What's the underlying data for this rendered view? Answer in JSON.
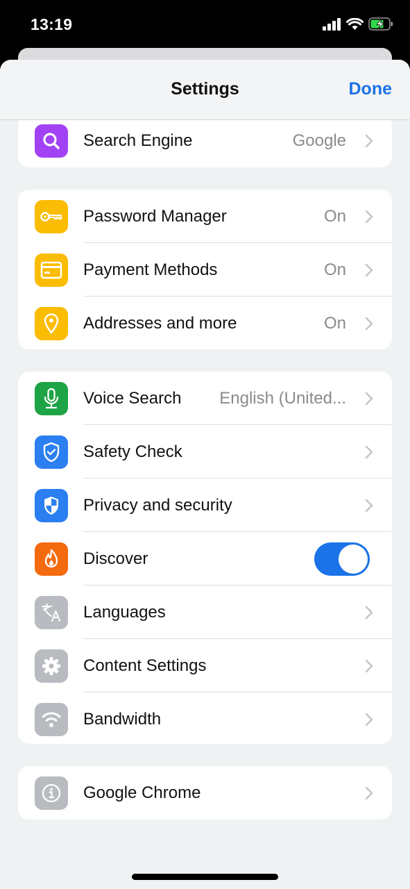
{
  "status_bar": {
    "time": "13:19",
    "icons": [
      "cellular-signal-icon",
      "wifi-icon",
      "battery-charging-icon"
    ]
  },
  "header": {
    "title": "Settings",
    "done_label": "Done"
  },
  "colors": {
    "accent": "#1a73e8",
    "background": "#eff2f3",
    "search_engine": "#a142f4",
    "autofill": "#fbbc04",
    "voice": "#1ea446",
    "safety": "#1a73e8",
    "discover": "#f46a0f",
    "neutral": "#b8bbbf"
  },
  "groups": [
    {
      "items": [
        {
          "id": "search-engine",
          "label": "Search Engine",
          "value": "Google",
          "icon": "search-icon"
        }
      ]
    },
    {
      "items": [
        {
          "id": "password-manager",
          "label": "Password Manager",
          "value": "On",
          "icon": "key-icon"
        },
        {
          "id": "payment-methods",
          "label": "Payment Methods",
          "value": "On",
          "icon": "credit-card-icon"
        },
        {
          "id": "addresses",
          "label": "Addresses and more",
          "value": "On",
          "icon": "location-pin-icon"
        }
      ]
    },
    {
      "items": [
        {
          "id": "voice-search",
          "label": "Voice Search",
          "value": "English (United...",
          "icon": "microphone-icon"
        },
        {
          "id": "safety-check",
          "label": "Safety Check",
          "value": "",
          "icon": "shield-check-icon"
        },
        {
          "id": "privacy-security",
          "label": "Privacy and security",
          "value": "",
          "icon": "shield-icon"
        },
        {
          "id": "discover",
          "label": "Discover",
          "toggle": true,
          "toggle_on": true,
          "icon": "flame-icon"
        },
        {
          "id": "languages",
          "label": "Languages",
          "value": "",
          "icon": "translate-icon"
        },
        {
          "id": "content-settings",
          "label": "Content Settings",
          "value": "",
          "icon": "gear-icon"
        },
        {
          "id": "bandwidth",
          "label": "Bandwidth",
          "value": "",
          "icon": "wifi-icon"
        }
      ]
    },
    {
      "items": [
        {
          "id": "google-chrome",
          "label": "Google Chrome",
          "value": "",
          "icon": "info-icon"
        }
      ]
    }
  ]
}
